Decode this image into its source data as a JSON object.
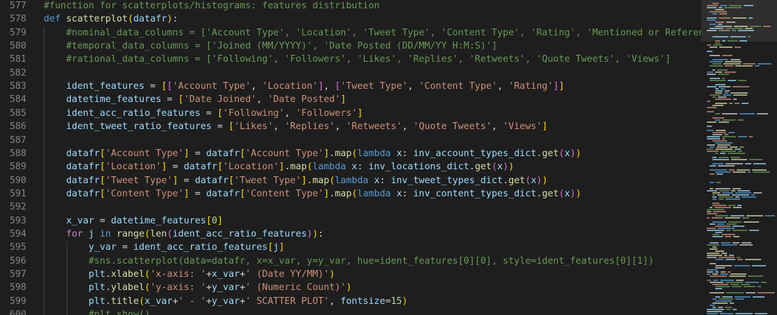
{
  "editor": {
    "lines": [
      {
        "num": "577",
        "tokens": [
          [
            "c",
            "#function for scatterplots/histograms: features distribution"
          ]
        ]
      },
      {
        "num": "578",
        "tokens": [
          [
            "k",
            "def "
          ],
          [
            "f",
            "scatterplot"
          ],
          [
            "b1",
            "("
          ],
          [
            "v",
            "datafr"
          ],
          [
            "b1",
            ")"
          ],
          [
            "o",
            ":"
          ]
        ]
      },
      {
        "num": "579",
        "tokens": [
          [
            "o",
            "    "
          ],
          [
            "c",
            "#nominal_data_columns = ['Account Type', 'Location', 'Tweet Type', 'Content Type', 'Rating', 'Mentioned or Referenced C"
          ]
        ]
      },
      {
        "num": "580",
        "tokens": [
          [
            "o",
            "    "
          ],
          [
            "c",
            "#temporal_data_columns = ['Joined (MM/YYYY)', 'Date Posted (DD/MM/YY H:M:S)']"
          ]
        ]
      },
      {
        "num": "581",
        "tokens": [
          [
            "o",
            "    "
          ],
          [
            "c",
            "#rational_data_columns = ['Following', 'Followers', 'Likes', 'Replies', 'Retweets', 'Quote Tweets', 'Views']"
          ]
        ]
      },
      {
        "num": "582",
        "tokens": []
      },
      {
        "num": "583",
        "tokens": [
          [
            "o",
            "    "
          ],
          [
            "v",
            "ident_features"
          ],
          [
            "o",
            " = "
          ],
          [
            "b1",
            "["
          ],
          [
            "b2",
            "["
          ],
          [
            "s",
            "'Account Type'"
          ],
          [
            "o",
            ", "
          ],
          [
            "s",
            "'Location'"
          ],
          [
            "b2",
            "]"
          ],
          [
            "o",
            ", "
          ],
          [
            "b2",
            "["
          ],
          [
            "s",
            "'Tweet Type'"
          ],
          [
            "o",
            ", "
          ],
          [
            "s",
            "'Content Type'"
          ],
          [
            "o",
            ", "
          ],
          [
            "s",
            "'Rating'"
          ],
          [
            "b2",
            "]"
          ],
          [
            "b1",
            "]"
          ]
        ]
      },
      {
        "num": "584",
        "tokens": [
          [
            "o",
            "    "
          ],
          [
            "v",
            "datetime_features"
          ],
          [
            "o",
            " = "
          ],
          [
            "b1",
            "["
          ],
          [
            "s",
            "'Date Joined'"
          ],
          [
            "o",
            ", "
          ],
          [
            "s",
            "'Date Posted'"
          ],
          [
            "b1",
            "]"
          ]
        ]
      },
      {
        "num": "585",
        "tokens": [
          [
            "o",
            "    "
          ],
          [
            "v",
            "ident_acc_ratio_features"
          ],
          [
            "o",
            " = "
          ],
          [
            "b1",
            "["
          ],
          [
            "s",
            "'Following'"
          ],
          [
            "o",
            ", "
          ],
          [
            "s",
            "'Followers'"
          ],
          [
            "b1",
            "]"
          ]
        ]
      },
      {
        "num": "586",
        "tokens": [
          [
            "o",
            "    "
          ],
          [
            "v",
            "ident_tweet_ratio_features"
          ],
          [
            "o",
            " = "
          ],
          [
            "b1",
            "["
          ],
          [
            "s",
            "'Likes'"
          ],
          [
            "o",
            ", "
          ],
          [
            "s",
            "'Replies'"
          ],
          [
            "o",
            ", "
          ],
          [
            "s",
            "'Retweets'"
          ],
          [
            "o",
            ", "
          ],
          [
            "s",
            "'Quote Tweets'"
          ],
          [
            "o",
            ", "
          ],
          [
            "s",
            "'Views'"
          ],
          [
            "b1",
            "]"
          ]
        ]
      },
      {
        "num": "587",
        "tokens": []
      },
      {
        "num": "588",
        "tokens": [
          [
            "o",
            "    "
          ],
          [
            "v",
            "datafr"
          ],
          [
            "b1",
            "["
          ],
          [
            "s",
            "'Account Type'"
          ],
          [
            "b1",
            "]"
          ],
          [
            "o",
            " = "
          ],
          [
            "v",
            "datafr"
          ],
          [
            "b1",
            "["
          ],
          [
            "s",
            "'Account Type'"
          ],
          [
            "b1",
            "]"
          ],
          [
            "o",
            "."
          ],
          [
            "f",
            "map"
          ],
          [
            "b1",
            "("
          ],
          [
            "k",
            "lambda "
          ],
          [
            "v",
            "x"
          ],
          [
            "o",
            ": "
          ],
          [
            "v",
            "inv_account_types_dict"
          ],
          [
            "o",
            "."
          ],
          [
            "f",
            "get"
          ],
          [
            "b2",
            "("
          ],
          [
            "v",
            "x"
          ],
          [
            "b2",
            ")"
          ],
          [
            "b1",
            ")"
          ]
        ]
      },
      {
        "num": "589",
        "tokens": [
          [
            "o",
            "    "
          ],
          [
            "v",
            "datafr"
          ],
          [
            "b1",
            "["
          ],
          [
            "s",
            "'Location'"
          ],
          [
            "b1",
            "]"
          ],
          [
            "o",
            " = "
          ],
          [
            "v",
            "datafr"
          ],
          [
            "b1",
            "["
          ],
          [
            "s",
            "'Location'"
          ],
          [
            "b1",
            "]"
          ],
          [
            "o",
            "."
          ],
          [
            "f",
            "map"
          ],
          [
            "b1",
            "("
          ],
          [
            "k",
            "lambda "
          ],
          [
            "v",
            "x"
          ],
          [
            "o",
            ": "
          ],
          [
            "v",
            "inv_locations_dict"
          ],
          [
            "o",
            "."
          ],
          [
            "f",
            "get"
          ],
          [
            "b2",
            "("
          ],
          [
            "v",
            "x"
          ],
          [
            "b2",
            ")"
          ],
          [
            "b1",
            ")"
          ]
        ]
      },
      {
        "num": "590",
        "tokens": [
          [
            "o",
            "    "
          ],
          [
            "v",
            "datafr"
          ],
          [
            "b1",
            "["
          ],
          [
            "s",
            "'Tweet Type'"
          ],
          [
            "b1",
            "]"
          ],
          [
            "o",
            " = "
          ],
          [
            "v",
            "datafr"
          ],
          [
            "b1",
            "["
          ],
          [
            "s",
            "'Tweet Type'"
          ],
          [
            "b1",
            "]"
          ],
          [
            "o",
            "."
          ],
          [
            "f",
            "map"
          ],
          [
            "b1",
            "("
          ],
          [
            "k",
            "lambda "
          ],
          [
            "v",
            "x"
          ],
          [
            "o",
            ": "
          ],
          [
            "v",
            "inv_tweet_types_dict"
          ],
          [
            "o",
            "."
          ],
          [
            "f",
            "get"
          ],
          [
            "b2",
            "("
          ],
          [
            "v",
            "x"
          ],
          [
            "b2",
            ")"
          ],
          [
            "b1",
            ")"
          ]
        ]
      },
      {
        "num": "591",
        "tokens": [
          [
            "o",
            "    "
          ],
          [
            "v",
            "datafr"
          ],
          [
            "b1",
            "["
          ],
          [
            "s",
            "'Content Type'"
          ],
          [
            "b1",
            "]"
          ],
          [
            "o",
            " = "
          ],
          [
            "v",
            "datafr"
          ],
          [
            "b1",
            "["
          ],
          [
            "s",
            "'Content Type'"
          ],
          [
            "b1",
            "]"
          ],
          [
            "o",
            "."
          ],
          [
            "f",
            "map"
          ],
          [
            "b1",
            "("
          ],
          [
            "k",
            "lambda "
          ],
          [
            "v",
            "x"
          ],
          [
            "o",
            ": "
          ],
          [
            "v",
            "inv_content_types_dict"
          ],
          [
            "o",
            "."
          ],
          [
            "f",
            "get"
          ],
          [
            "b2",
            "("
          ],
          [
            "v",
            "x"
          ],
          [
            "b2",
            ")"
          ],
          [
            "b1",
            ")"
          ]
        ]
      },
      {
        "num": "592",
        "tokens": []
      },
      {
        "num": "593",
        "tokens": [
          [
            "o",
            "    "
          ],
          [
            "v",
            "x_var"
          ],
          [
            "o",
            " = "
          ],
          [
            "v",
            "datetime_features"
          ],
          [
            "b1",
            "["
          ],
          [
            "n",
            "0"
          ],
          [
            "b1",
            "]"
          ]
        ]
      },
      {
        "num": "594",
        "tokens": [
          [
            "o",
            "    "
          ],
          [
            "kc",
            "for "
          ],
          [
            "v",
            "j"
          ],
          [
            "k",
            " in "
          ],
          [
            "f",
            "range"
          ],
          [
            "b1",
            "("
          ],
          [
            "f",
            "len"
          ],
          [
            "b2",
            "("
          ],
          [
            "v",
            "ident_acc_ratio_features"
          ],
          [
            "b2",
            ")"
          ],
          [
            "b1",
            ")"
          ],
          [
            "o",
            ":"
          ]
        ]
      },
      {
        "num": "595",
        "tokens": [
          [
            "o",
            "        "
          ],
          [
            "v",
            "y_var"
          ],
          [
            "o",
            " = "
          ],
          [
            "v",
            "ident_acc_ratio_features"
          ],
          [
            "b1",
            "["
          ],
          [
            "v",
            "j"
          ],
          [
            "b1",
            "]"
          ]
        ]
      },
      {
        "num": "596",
        "tokens": [
          [
            "o",
            "        "
          ],
          [
            "c",
            "#sns.scatterplot(data=datafr, x=x_var, y=y_var, hue=ident_features[0][0], style=ident_features[0][1])"
          ]
        ]
      },
      {
        "num": "597",
        "tokens": [
          [
            "o",
            "        "
          ],
          [
            "v",
            "plt"
          ],
          [
            "o",
            "."
          ],
          [
            "f",
            "xlabel"
          ],
          [
            "b1",
            "("
          ],
          [
            "s",
            "'x-axis: '"
          ],
          [
            "o",
            "+"
          ],
          [
            "v",
            "x_var"
          ],
          [
            "o",
            "+"
          ],
          [
            "s",
            "' (Date YY/MM)'"
          ],
          [
            "b1",
            ")"
          ]
        ]
      },
      {
        "num": "598",
        "tokens": [
          [
            "o",
            "        "
          ],
          [
            "v",
            "plt"
          ],
          [
            "o",
            "."
          ],
          [
            "f",
            "ylabel"
          ],
          [
            "b1",
            "("
          ],
          [
            "s",
            "'y-axis: '"
          ],
          [
            "o",
            "+"
          ],
          [
            "v",
            "y_var"
          ],
          [
            "o",
            "+"
          ],
          [
            "s",
            "' (Numeric Count)'"
          ],
          [
            "b1",
            ")"
          ]
        ]
      },
      {
        "num": "599",
        "tokens": [
          [
            "o",
            "        "
          ],
          [
            "v",
            "plt"
          ],
          [
            "o",
            "."
          ],
          [
            "f",
            "title"
          ],
          [
            "b1",
            "("
          ],
          [
            "v",
            "x_var"
          ],
          [
            "o",
            "+"
          ],
          [
            "s",
            "' - '"
          ],
          [
            "o",
            "+"
          ],
          [
            "v",
            "y_var"
          ],
          [
            "o",
            "+"
          ],
          [
            "s",
            "' SCATTER PLOT'"
          ],
          [
            "o",
            ", "
          ],
          [
            "v",
            "fontsize"
          ],
          [
            "o",
            "="
          ],
          [
            "n",
            "15"
          ],
          [
            "b1",
            ")"
          ]
        ]
      },
      {
        "num": "600",
        "tokens": [
          [
            "o",
            "        "
          ],
          [
            "c",
            "#plt.show()"
          ]
        ]
      }
    ]
  },
  "colors": {
    "background": "#1e1e1e",
    "comment": "#6a9955",
    "keyword": "#569cd6",
    "function": "#dcdcaa",
    "variable": "#9cdcfe",
    "string": "#ce9178",
    "number": "#b5cea8"
  }
}
